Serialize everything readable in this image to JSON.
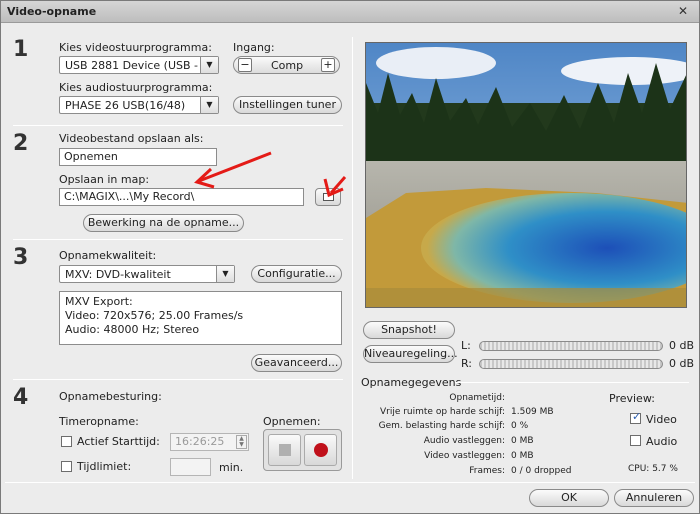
{
  "window": {
    "title": "Video-opname",
    "close_glyph": "✕"
  },
  "step1": {
    "number": "1",
    "video_driver_label": "Kies videostuurprogramma:",
    "video_driver_value": "USB 2881 Device (USB - ...",
    "input_label": "Ingang:",
    "input_value": "Comp",
    "minus": "−",
    "plus": "+",
    "audio_driver_label": "Kies audiostuurprogramma:",
    "audio_driver_value": "PHASE 26 USB(16/48)",
    "tuner_button": "Instellingen tuner"
  },
  "step2": {
    "number": "2",
    "save_as_label": "Videobestand opslaan als:",
    "filename_value": "Opnemen",
    "folder_label": "Opslaan in map:",
    "folder_value": "C:\\MAGIX\\...\\My Record\\",
    "edit_button": "Bewerking na de opname..."
  },
  "step3": {
    "number": "3",
    "quality_label": "Opnamekwaliteit:",
    "quality_value": "MXV: DVD-kwaliteit",
    "config_button": "Configuratie...",
    "info_lines": [
      "MXV Export:",
      "Video: 720x576; 25.00 Frames/s",
      "Audio: 48000 Hz; Stereo"
    ],
    "advanced_button": "Geavanceerd..."
  },
  "step4": {
    "number": "4",
    "control_label": "Opnamebesturing:",
    "timer_label": "Timeropname:",
    "start_time_label": "Actief Starttijd:",
    "start_time_value": "16:26:25",
    "time_limit_label": "Tijdlimiet:",
    "time_limit_value": "",
    "minutes_unit": "min.",
    "record_label": "Opnemen:"
  },
  "right": {
    "snapshot_button": "Snapshot!",
    "level_button": "Niveauregeling...",
    "left_channel": "L:",
    "right_channel": "R:",
    "left_db": "0 dB",
    "right_db": "0 dB",
    "recording_data_label": "Opnamegegevens",
    "stats": [
      {
        "key": "Opnametijd:",
        "value": ""
      },
      {
        "key": "Vrije ruimte op harde schijf:",
        "value": "1.509 MB"
      },
      {
        "key": "Gem. belasting harde schijf:",
        "value": "0 %"
      },
      {
        "key": "Audio vastleggen:",
        "value": "0 MB"
      },
      {
        "key": "Video vastleggen:",
        "value": "0 MB"
      },
      {
        "key": "Frames:",
        "value": "0 / 0 dropped"
      }
    ],
    "preview_label": "Preview:",
    "preview_video": "Video",
    "preview_audio": "Audio",
    "cpu": "CPU: 5.7 %"
  },
  "footer": {
    "ok_button": "OK",
    "cancel_button": "Annuleren"
  },
  "colors": {
    "annotation_red": "#e41b17",
    "record_red": "#c0101a"
  }
}
